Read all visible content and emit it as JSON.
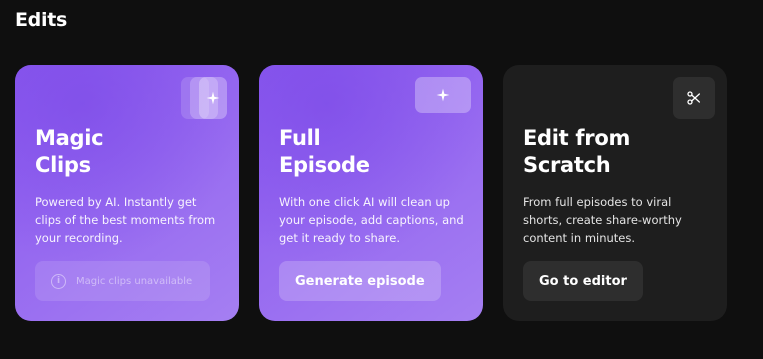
{
  "section": {
    "title": "Edits"
  },
  "cards": [
    {
      "title": "Magic\nClips",
      "description": "Powered by AI. Instantly get clips of the best moments from your recording.",
      "button": {
        "label": "Magic clips unavailable",
        "state": "disabled",
        "icon": "info-icon"
      },
      "badge_icon": "sparkle-icon"
    },
    {
      "title": "Full\nEpisode",
      "description": "With one click AI will clean up your episode, add captions, and get it ready to share.",
      "button": {
        "label": "Generate episode",
        "state": "enabled"
      },
      "badge_icon": "sparkle-icon"
    },
    {
      "title": "Edit from\nScratch",
      "description": "From full episodes to viral shorts, create share-worthy content in minutes.",
      "button": {
        "label": "Go to editor",
        "state": "enabled"
      },
      "badge_icon": "scissors-icon"
    }
  ],
  "colors": {
    "background": "#0f0f0f",
    "accent_purple": "#8a58ee",
    "dark_card": "#1e1e1e"
  }
}
